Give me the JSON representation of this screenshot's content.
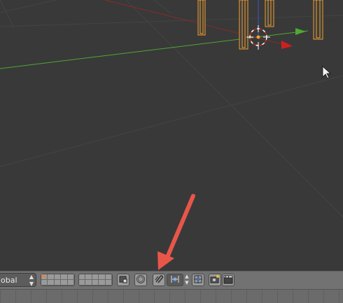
{
  "header": {
    "orientation_value": "obal",
    "stepper_glyph": "⇕",
    "icons": {
      "camera_lock": "camera-lock-icon",
      "proportional": "proportional-edit-icon",
      "magnet": "snap-magnet-icon",
      "snap_element": "snap-element-icon",
      "render_layer": "render-icon",
      "clapper": "clapper-icon"
    }
  },
  "colors": {
    "viewport_bg": "#393939",
    "header_bg": "#727272",
    "x_axis": "#8b2a2a",
    "y_axis": "#4ea832",
    "selection": "#f2a12a",
    "annotation_arrow": "#e8564a"
  }
}
